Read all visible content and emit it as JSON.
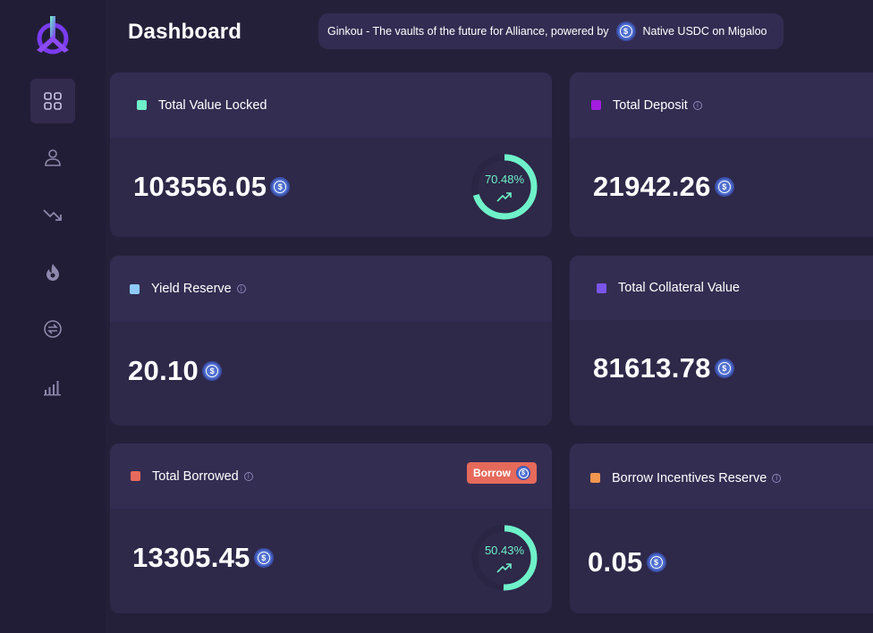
{
  "page_title": "Dashboard",
  "banner": {
    "text_before": "Ginkou - The vaults of the future for Alliance, powered by",
    "text_after": "Native USDC on Migaloo"
  },
  "sidebar": {
    "items": [
      {
        "icon": "grid-icon",
        "active": true
      },
      {
        "icon": "user-icon",
        "active": false
      },
      {
        "icon": "trending-down-icon",
        "active": false
      },
      {
        "icon": "flame-icon",
        "active": false
      },
      {
        "icon": "swap-icon",
        "active": false
      },
      {
        "icon": "bar-chart-icon",
        "active": false
      }
    ]
  },
  "cards": {
    "tvl": {
      "label": "Total Value Locked",
      "value": "103556.05",
      "percent": "70.48%",
      "percent_value": 70.48,
      "color": "#6ff2c9"
    },
    "deposit": {
      "label": "Total Deposit",
      "value": "21942.26",
      "color": "#a21de0"
    },
    "yield": {
      "label": "Yield Reserve",
      "value": "20.10",
      "color": "#8ecbf7"
    },
    "collateral": {
      "label": "Total Collateral Value",
      "value": "81613.78",
      "color": "#7a55ea"
    },
    "borrowed": {
      "label": "Total Borrowed",
      "value": "13305.45",
      "button": "Borrow",
      "percent": "50.43%",
      "percent_value": 50.43,
      "color": "#e66a5c"
    },
    "incentives": {
      "label": "Borrow Incentives Reserve",
      "value": "0.05",
      "color": "#f0964f"
    }
  },
  "colors": {
    "accent": "#6ff2c9",
    "coin": "#4f6fd0",
    "background": "#25203a",
    "card": "#2e2849"
  }
}
